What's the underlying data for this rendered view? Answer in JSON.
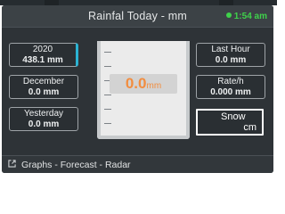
{
  "header": {
    "title": "Rainfal Today - mm",
    "time": "1:54 am",
    "status_color": "#3fd24b"
  },
  "left_tiles": [
    {
      "label": "2020",
      "value": "438.1 mm"
    },
    {
      "label": "December",
      "value": "0.0 mm"
    },
    {
      "label": "Yesterday",
      "value": "0.0 mm"
    }
  ],
  "right_tiles": [
    {
      "label": "Last Hour",
      "value": "0.0 mm"
    },
    {
      "label": "Rate/h",
      "value": "0.000 mm"
    }
  ],
  "snow": {
    "label": "Snow",
    "unit": "cm"
  },
  "gauge": {
    "value": "0.0",
    "unit": "mm",
    "color": "#f28d3f"
  },
  "footer": {
    "links": "Graphs - Forecast - Radar",
    "icon": "external-link-icon"
  },
  "colors": {
    "accent": "#2bb3d3",
    "panel": "#2e3337"
  }
}
